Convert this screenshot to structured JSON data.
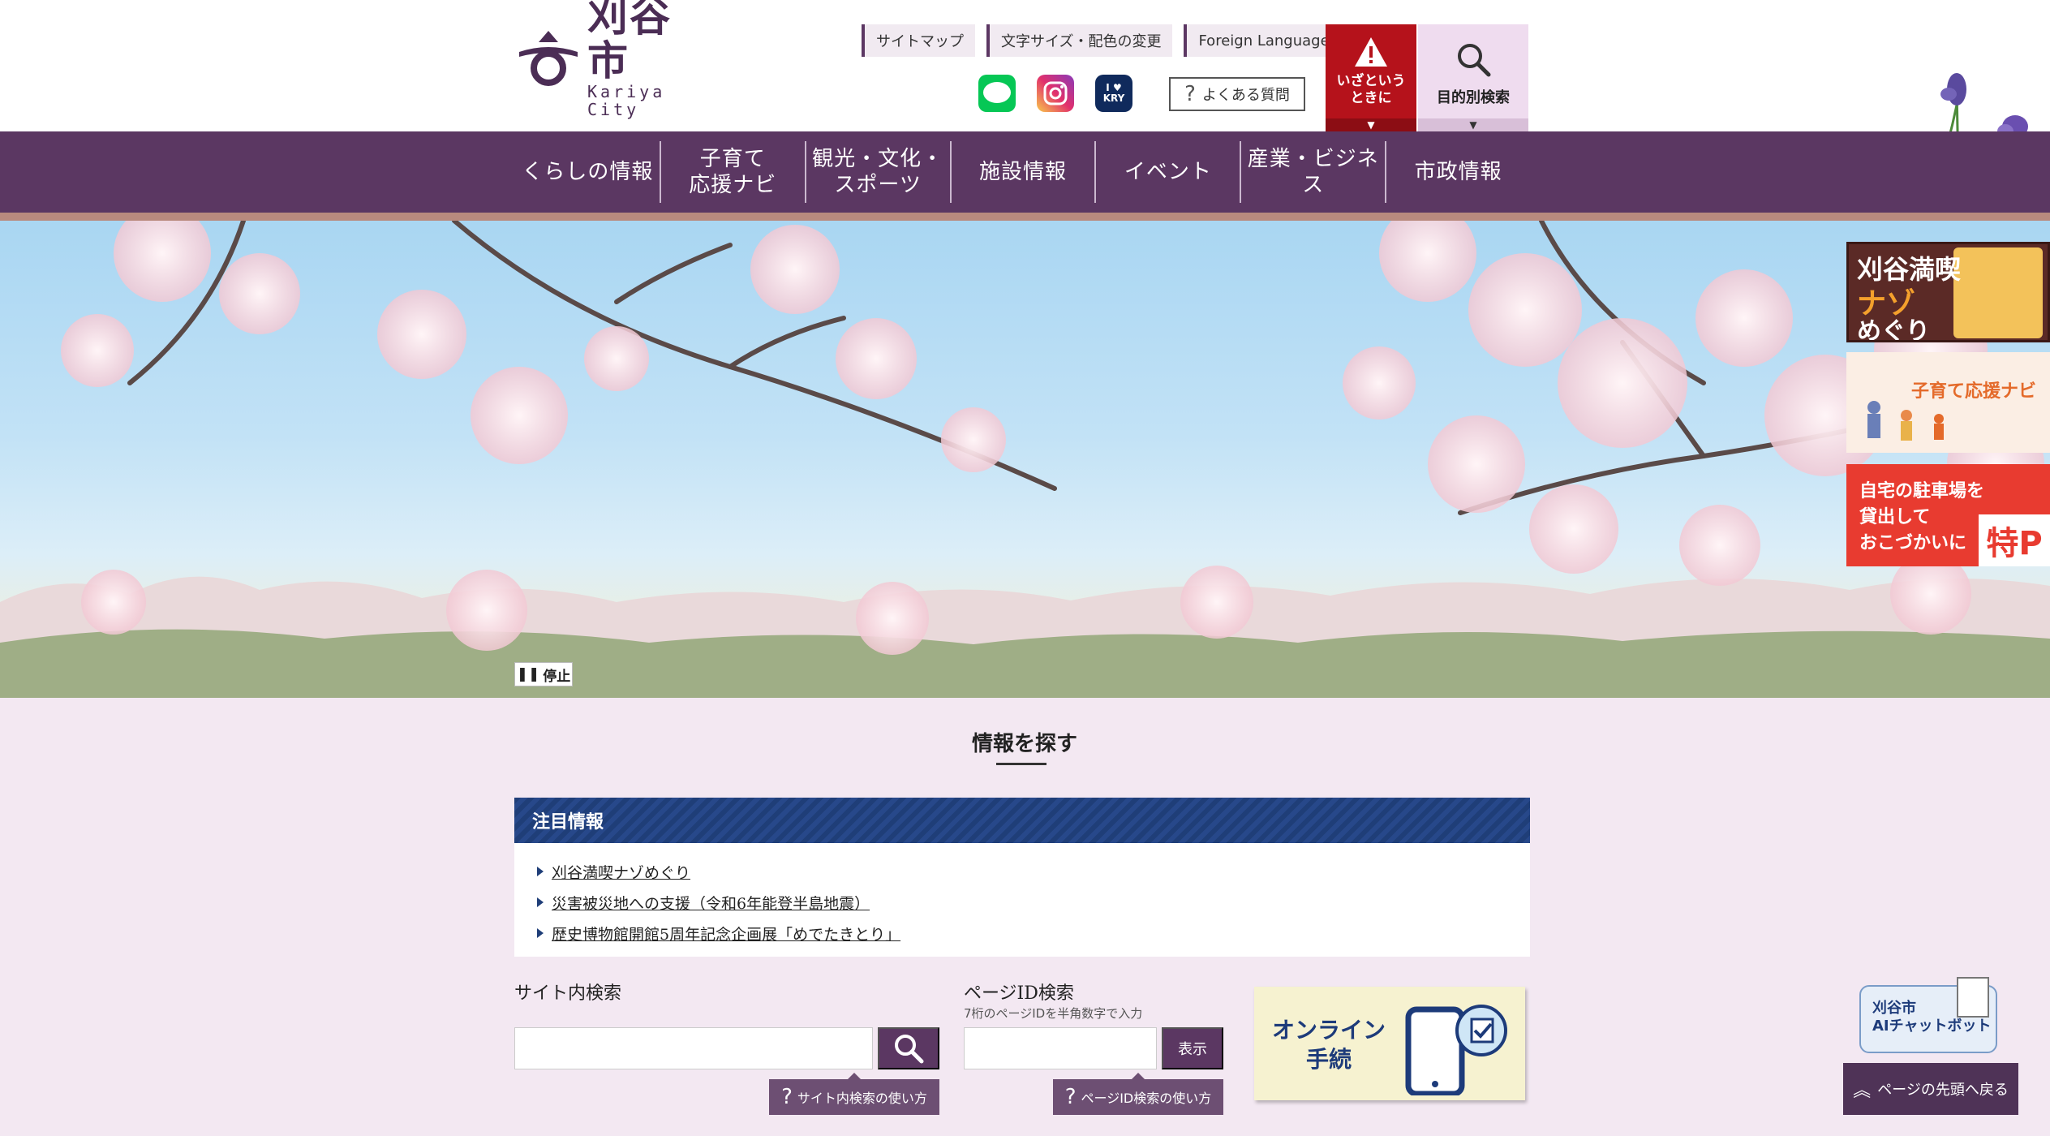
{
  "header": {
    "logo_ja": "刈谷市",
    "logo_en": "Kariya City",
    "top_links": [
      "サイトマップ",
      "文字サイズ・配色の変更",
      "Foreign Language"
    ],
    "sns": {
      "line": "LINE",
      "kry_top": "I ♥",
      "kry_bottom": "KRY"
    },
    "faq": "よくある質問",
    "emergency_line1": "いざという",
    "emergency_line2": "ときに",
    "purpose_search": "目的別検索",
    "arrow": "▼"
  },
  "nav": {
    "items": [
      {
        "line1": "くらしの情報",
        "line2": ""
      },
      {
        "line1": "子育て",
        "line2": "応援ナビ"
      },
      {
        "line1": "観光・文化・",
        "line2": "スポーツ"
      },
      {
        "line1": "施設情報",
        "line2": ""
      },
      {
        "line1": "イベント",
        "line2": ""
      },
      {
        "line1": "産業・ビジネス",
        "line2": ""
      },
      {
        "line1": "市政情報",
        "line2": ""
      }
    ]
  },
  "hero": {
    "stop_label": "停止",
    "stop_icon": "❚❚"
  },
  "banners": {
    "nazo_line1": "刈谷満喫",
    "nazo_line2": "ナゾ",
    "nazo_line3": "めぐり",
    "kosodate": "子育て応援ナビ",
    "parking_line1": "自宅の駐車場を",
    "parking_line2": "貸出して",
    "parking_line3": "おこづかいに",
    "parking_logo": "特P"
  },
  "main": {
    "section_title": "情報を探す",
    "notice_title": "注目情報",
    "notices": [
      "刈谷満喫ナゾめぐり",
      "災害被災地への支援（令和6年能登半島地震）",
      "歴史博物館開館5周年記念企画展「めでたきとり」"
    ],
    "site_search_label": "サイト内検索",
    "site_search_help": "サイト内検索の使い方",
    "page_id_label": "ページID検索",
    "page_id_hint": "7桁のページIDを半角数字で入力",
    "page_id_button": "表示",
    "page_id_help": "ページID検索の使い方",
    "help_icon": "?",
    "online_line1": "オンライン",
    "online_line2": "手続"
  },
  "floating": {
    "chatbot_line1": "刈谷市",
    "chatbot_line2": "AIチャットボット",
    "pagetop": "ページの先頭へ戻る",
    "pagetop_icon": "︽"
  },
  "colors": {
    "brand_purple": "#5b3762",
    "emergency_red": "#b5121b",
    "notice_navy": "#1f3e78",
    "page_bg": "#f3e8f2"
  }
}
